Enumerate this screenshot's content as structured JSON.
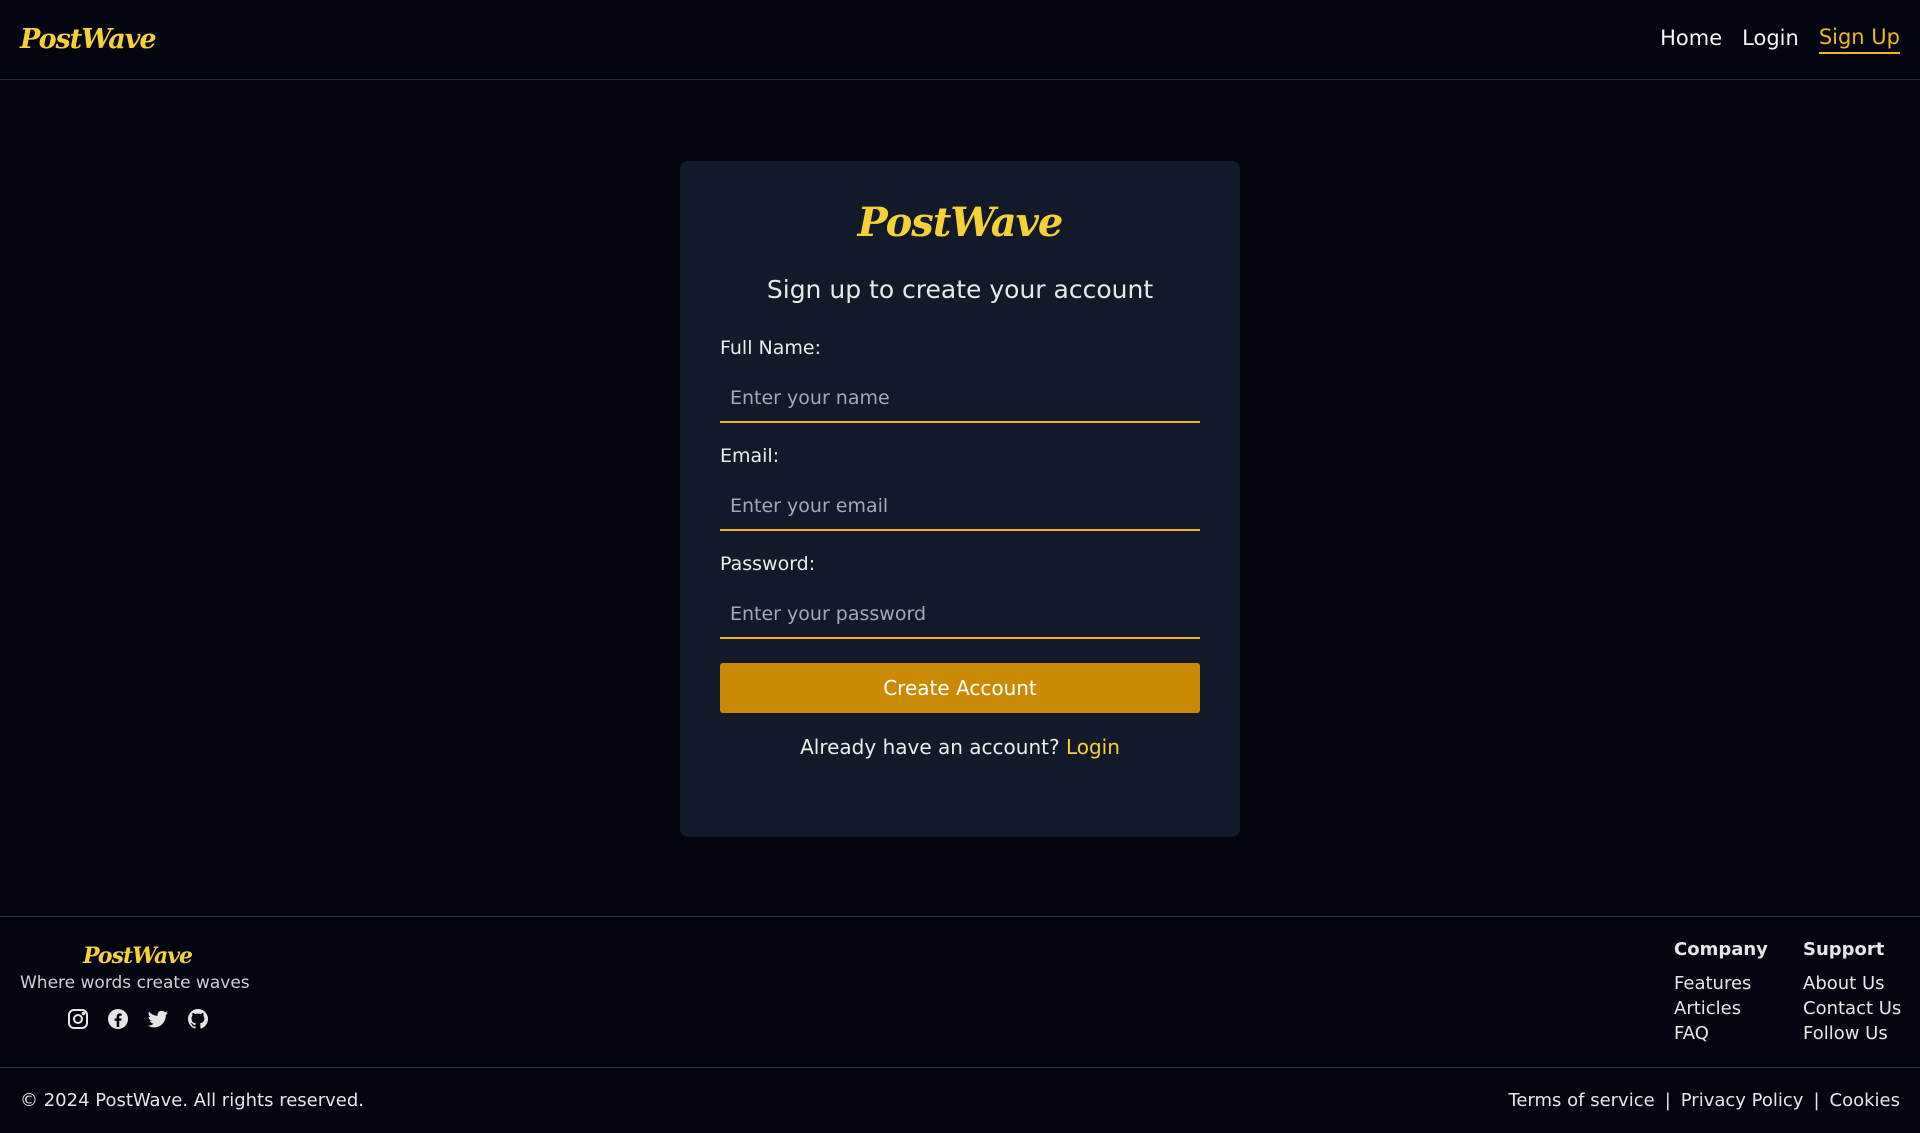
{
  "header": {
    "brand": "PostWave",
    "nav": {
      "home": "Home",
      "login": "Login",
      "signup": "Sign Up"
    }
  },
  "card": {
    "brand": "PostWave",
    "subtitle": "Sign up to create your account",
    "fields": {
      "name": {
        "label": "Full Name:",
        "placeholder": "Enter your name"
      },
      "email": {
        "label": "Email:",
        "placeholder": "Enter your email"
      },
      "password": {
        "label": "Password:",
        "placeholder": "Enter your password"
      }
    },
    "submit_label": "Create Account",
    "switch_text": "Already have an account?",
    "switch_link": "Login"
  },
  "footer": {
    "brand": "PostWave",
    "tagline": "Where words create waves",
    "socials": [
      "instagram-icon",
      "facebook-icon",
      "twitter-icon",
      "github-icon"
    ],
    "company": {
      "title": "Company",
      "links": [
        "Features",
        "Articles",
        "FAQ"
      ]
    },
    "support": {
      "title": "Support",
      "links": [
        "About Us",
        "Contact Us",
        "Follow Us"
      ]
    },
    "copyright": "© 2024 PostWave. All rights reserved.",
    "legal": {
      "terms": "Terms of service",
      "privacy": "Privacy Policy",
      "cookies": "Cookies",
      "sep": "|"
    }
  },
  "colors": {
    "accent": "#f0b71c",
    "brand": "#f7d038",
    "button": "#ca8a04",
    "background": "#02040f",
    "card": "#121928"
  }
}
